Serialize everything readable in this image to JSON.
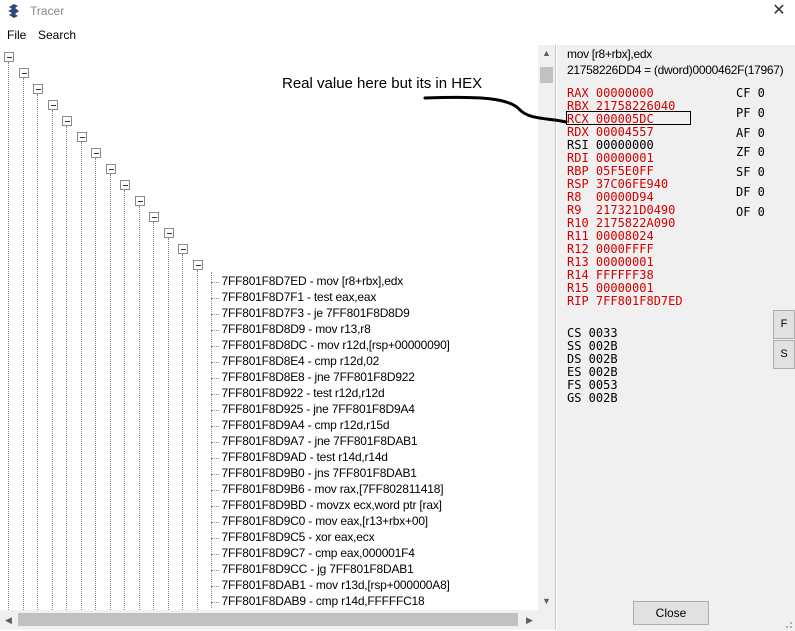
{
  "window": {
    "title": "Tracer",
    "close_glyph": "✕"
  },
  "menu": {
    "items": [
      {
        "label": "File"
      },
      {
        "label": "Search"
      }
    ]
  },
  "trace_entries": [
    "7FF801F8D7ED - mov [r8+rbx],edx",
    "7FF801F8D7F1 - test eax,eax",
    "7FF801F8D7F3 - je 7FF801F8D8D9",
    "7FF801F8D8D9 - mov r13,r8",
    "7FF801F8D8DC - mov r12d,[rsp+00000090]",
    "7FF801F8D8E4 - cmp r12d,02",
    "7FF801F8D8E8 - jne 7FF801F8D922",
    "7FF801F8D922 - test r12d,r12d",
    "7FF801F8D925 - jne 7FF801F8D9A4",
    "7FF801F8D9A4 - cmp r12d,r15d",
    "7FF801F8D9A7 - jne 7FF801F8DAB1",
    "7FF801F8D9AD - test r14d,r14d",
    "7FF801F8D9B0 - jns 7FF801F8DAB1",
    "7FF801F8D9B6 - mov rax,[7FF802811418]",
    "7FF801F8D9BD - movzx ecx,word ptr [rax]",
    "7FF801F8D9C0 - mov eax,[r13+rbx+00]",
    "7FF801F8D9C5 - xor eax,ecx",
    "7FF801F8D9C7 - cmp eax,000001F4",
    "7FF801F8D9CC - jg 7FF801F8DAB1",
    "7FF801F8DAB1 - mov r13d,[rsp+000000A8]",
    "7FF801F8DAB9 - cmp r14d,FFFFFC18"
  ],
  "details": {
    "instruction": "mov [r8+rbx],edx",
    "value": "21758226DD4 = (dword)0000462F(17967)"
  },
  "registers": [
    {
      "name": "RAX",
      "value": "00000000",
      "color": "#d40000"
    },
    {
      "name": "RBX",
      "value": "21758226040",
      "color": "#d40000"
    },
    {
      "name": "RCX",
      "value": "000005DC",
      "color": "#d40000"
    },
    {
      "name": "RDX",
      "value": "00004557",
      "color": "#d40000"
    },
    {
      "name": "RSI",
      "value": "00000000",
      "color": "#000000"
    },
    {
      "name": "RDI",
      "value": "00000001",
      "color": "#d40000"
    },
    {
      "name": "RBP",
      "value": "05F5E0FF",
      "color": "#d40000"
    },
    {
      "name": "RSP",
      "value": "37C06FE940",
      "color": "#d40000"
    },
    {
      "name": "R8",
      "value": "00000D94",
      "color": "#d40000"
    },
    {
      "name": "R9",
      "value": "217321D0490",
      "color": "#d40000"
    },
    {
      "name": "R10",
      "value": "2175822A090",
      "color": "#d40000"
    },
    {
      "name": "R11",
      "value": "00008024",
      "color": "#d40000"
    },
    {
      "name": "R12",
      "value": "0000FFFF",
      "color": "#d40000"
    },
    {
      "name": "R13",
      "value": "00000001",
      "color": "#d40000"
    },
    {
      "name": "R14",
      "value": "FFFFFF38",
      "color": "#d40000"
    },
    {
      "name": "R15",
      "value": "00000001",
      "color": "#d40000"
    },
    {
      "name": "RIP",
      "value": "7FF801F8D7ED",
      "color": "#d40000"
    }
  ],
  "flags": [
    {
      "name": "CF",
      "value": "0"
    },
    {
      "name": "PF",
      "value": "0"
    },
    {
      "name": "AF",
      "value": "0"
    },
    {
      "name": "ZF",
      "value": "0"
    },
    {
      "name": "SF",
      "value": "0"
    },
    {
      "name": "DF",
      "value": "0"
    },
    {
      "name": "OF",
      "value": "0"
    }
  ],
  "segments": [
    {
      "name": "CS",
      "value": "0033"
    },
    {
      "name": "SS",
      "value": "002B"
    },
    {
      "name": "DS",
      "value": "002B"
    },
    {
      "name": "ES",
      "value": "002B"
    },
    {
      "name": "FS",
      "value": "0053"
    },
    {
      "name": "GS",
      "value": "002B"
    }
  ],
  "buttons": {
    "f": "F",
    "s": "S",
    "close": "Close"
  },
  "annotation": "Real value here but its in HEX"
}
